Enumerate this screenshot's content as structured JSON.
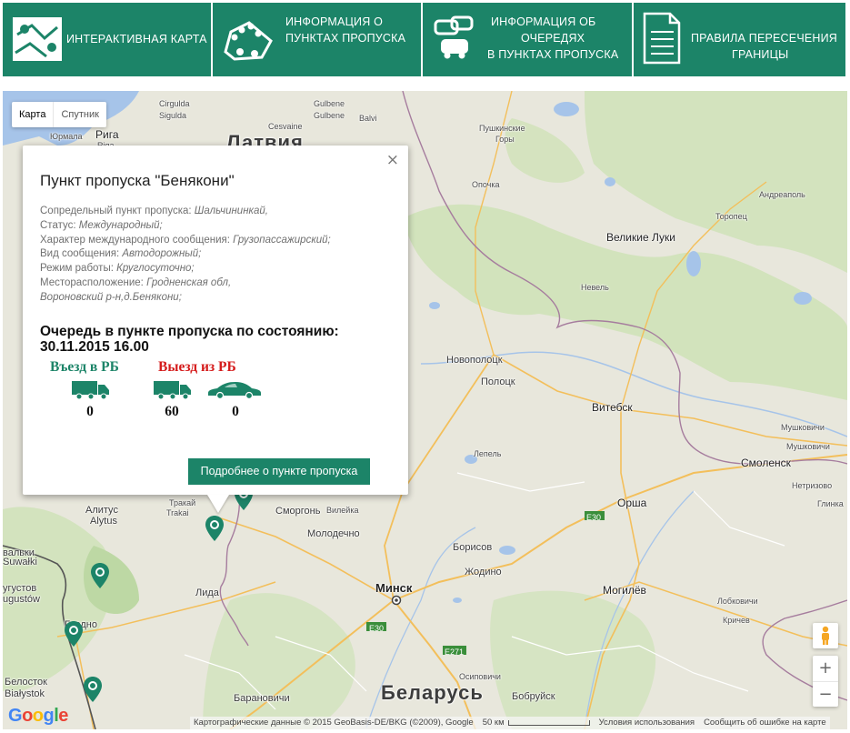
{
  "nav": {
    "items": [
      {
        "label_lines": [
          "ИНТЕРАКТИВНАЯ КАРТА"
        ]
      },
      {
        "label_lines": [
          "ИНФОРМАЦИЯ О",
          "ПУНКТАХ ПРОПУСКА"
        ]
      },
      {
        "label_lines": [
          "ИНФОРМАЦИЯ ОБ",
          "ОЧЕРЕДЯХ",
          "В ПУНКТАХ ПРОПУСКА"
        ]
      },
      {
        "label_lines": [
          "ПРАВИЛА ПЕРЕСЕЧЕНИЯ",
          "ГРАНИЦЫ"
        ]
      }
    ]
  },
  "map": {
    "type_buttons": {
      "map": "Карта",
      "satellite": "Спутник"
    },
    "zoom": {
      "in": "+",
      "out": "−"
    },
    "attribution": {
      "data": "Картографические данные © 2015 GeoBasis-DE/BKG (©2009), Google",
      "scale": "50 км",
      "terms": "Условия использования",
      "report": "Сообщить об ошибке на карте"
    },
    "logo": {
      "g1": "G",
      "o1": "o",
      "o2": "o",
      "g2": "g",
      "l": "l",
      "e": "e"
    },
    "labels": {
      "sigulda": "Sigulda",
      "cirgulda": "Cirgulda",
      "gulbene": "Gulbene",
      "cesvaine": "Cesvaine",
      "balvi": "Balvi",
      "jurmala": "Юрмала",
      "riga": "Рига",
      "riga_lat": "Riga",
      "latvia": "Латвия",
      "pushkinskie": "Пушкинские",
      "gory": "Горы",
      "opochka": "Опочка",
      "andreapol": "Андреаполь",
      "toropets": "Торопец",
      "velikie_luki": "Великие Луки",
      "nevel": "Невель",
      "novopolotsk": "Новополоцк",
      "polotsk": "Полоцк",
      "vitebsk": "Витебск",
      "lepel": "Лепель",
      "mushkovichi": "Мушковичи",
      "smolensk": "Смоленск",
      "netryzovo": "Нетризово",
      "glinka": "Глинка",
      "orsha": "Орша",
      "e30a": "E30",
      "trakai": "Тракай",
      "trakai_lat": "Trakai",
      "alitus": "Алитус",
      "alytus": "Alytus",
      "smorgon": "Сморгонь",
      "vileika": "Вилейка",
      "molodechno": "Молодечно",
      "borisov": "Борисов",
      "zhodino": "Жодино",
      "minsk": "Минск",
      "mogilev": "Могилёв",
      "lobkovichi": "Лобковичи",
      "krichev": "Кричев",
      "lida": "Лида",
      "grodno": "Гродно",
      "e30b": "E30",
      "e271": "E271",
      "osipovichi": "Осиповичи",
      "belarus": "Беларусь",
      "baranovichi": "Барановичи",
      "bobruisk": "Бобруйск",
      "bialystok_ru": "Белосток",
      "bialystok": "Białystok",
      "suwalki": "Suwałki",
      "augustow1": "угустов",
      "augustow2": "ugustów",
      "kvalki": "вальки"
    }
  },
  "infowindow": {
    "title": "Пункт пропуска \"Бенякони\"",
    "close": "×",
    "props": [
      {
        "label": "Сопредельный пункт пропуска: ",
        "value": "Шальчининкай,"
      },
      {
        "label": "Статус: ",
        "value": "Международный;"
      },
      {
        "label": "Характер международного сообщения: ",
        "value": "Грузопассажирский;"
      },
      {
        "label": "Вид сообщения: ",
        "value": "Автодорожный;"
      },
      {
        "label": "Режим работы: ",
        "value": "Круглосуточно;"
      },
      {
        "label": "Месторасположение: ",
        "value": "Гродненская обл,"
      },
      {
        "label": "",
        "value": "Вороновский р-н,д.Бенякони;"
      }
    ],
    "queue_title_line1": "Очередь в пункте пропуска по состоянию:",
    "queue_title_line2": "30.11.2015 16.00",
    "entry_label": "Въезд в РБ",
    "exit_label": "Выезд из РБ",
    "entry_trucks": "0",
    "exit_trucks": "60",
    "exit_cars": "0",
    "more_button": "Подробнее о пункте пропуска"
  },
  "colors": {
    "brand": "#1c8468",
    "exit": "#d51b1b"
  }
}
